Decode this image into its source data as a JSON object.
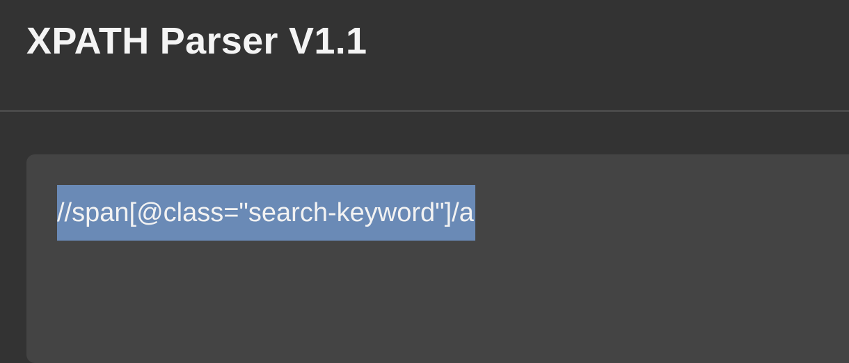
{
  "header": {
    "title": "XPATH Parser V1.1"
  },
  "editor": {
    "value": "//span[@class=\"search-keyword\"]/a",
    "selected": true
  },
  "colors": {
    "background": "#333333",
    "editor_background": "#444444",
    "selection": "#6a8ab6",
    "text": "#f2f2f2"
  }
}
